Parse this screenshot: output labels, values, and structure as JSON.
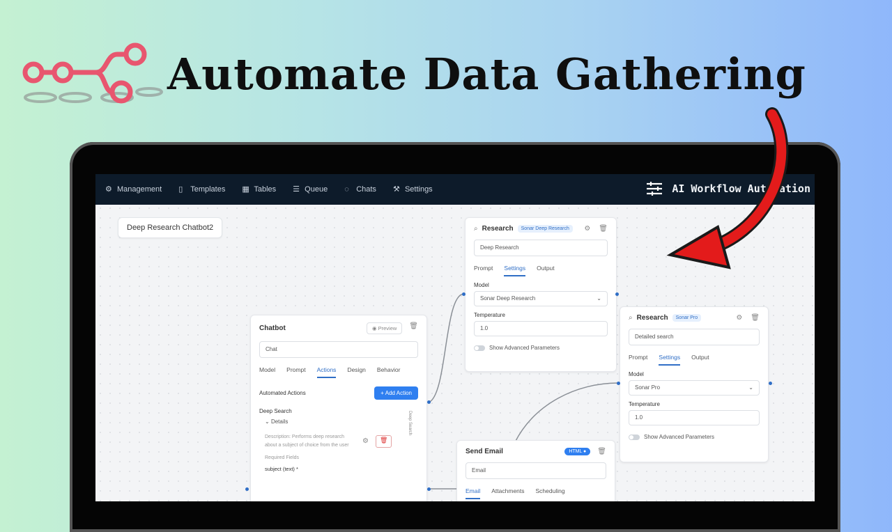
{
  "headline": "Automate Data Gathering",
  "nav": {
    "items": [
      {
        "label": "Management",
        "icon": "gear-icon"
      },
      {
        "label": "Templates",
        "icon": "document-icon"
      },
      {
        "label": "Tables",
        "icon": "table-icon"
      },
      {
        "label": "Queue",
        "icon": "queue-icon"
      },
      {
        "label": "Chats",
        "icon": "chat-icon"
      },
      {
        "label": "Settings",
        "icon": "wrench-icon"
      }
    ],
    "brand": "AI Workflow Automation"
  },
  "canvas": {
    "workflow_name": "Deep Research Chatbot2",
    "research1": {
      "title": "Research",
      "badge": "Sonar Deep Research",
      "name": "Deep Research",
      "tabs": [
        "Prompt",
        "Settings",
        "Output"
      ],
      "model_label": "Model",
      "model": "Sonar Deep Research",
      "temp_label": "Temperature",
      "temp": "1.0",
      "advanced": "Show Advanced Parameters"
    },
    "research2": {
      "title": "Research",
      "badge": "Sonar Pro",
      "name": "Detailed search",
      "tabs": [
        "Prompt",
        "Settings",
        "Output"
      ],
      "model_label": "Model",
      "model": "Sonar Pro",
      "temp_label": "Temperature",
      "temp": "1.0",
      "advanced": "Show Advanced Parameters"
    },
    "chatbot": {
      "title": "Chatbot",
      "preview": "Preview",
      "name": "Chat",
      "tabs": [
        "Model",
        "Prompt",
        "Actions",
        "Design",
        "Behavior"
      ],
      "automated": "Automated Actions",
      "add": "+ Add Action",
      "action": "Deep Search",
      "details": "Details",
      "description": "Description: Performs deep research about a subject of choice from the user",
      "required": "Required Fields",
      "field": "subject (text) *",
      "side_label": "Deep Search"
    },
    "email": {
      "title": "Send Email",
      "toggle": "HTML",
      "name": "Email",
      "tabs": [
        "Email",
        "Attachments",
        "Scheduling"
      ]
    }
  }
}
